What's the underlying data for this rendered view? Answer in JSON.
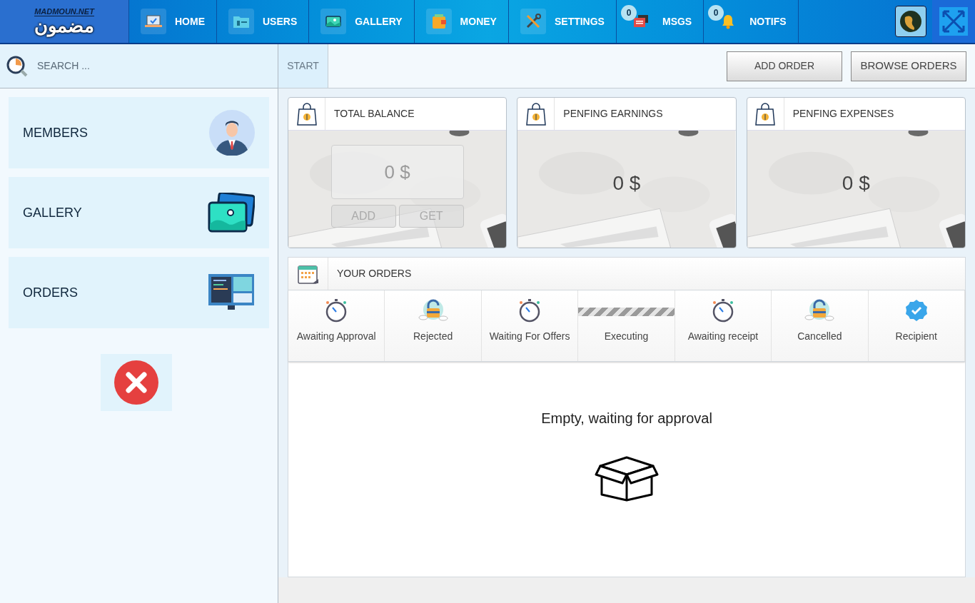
{
  "logo": {
    "latin": "MADMOUN.NET",
    "arabic": "مضمون"
  },
  "nav": [
    {
      "label": "HOME",
      "kind": "home"
    },
    {
      "label": "USERS",
      "kind": "users"
    },
    {
      "label": "GALLERY",
      "kind": "gallery"
    },
    {
      "label": "MONEY",
      "kind": "money"
    },
    {
      "label": "SETTINGS",
      "kind": "settings"
    },
    {
      "label": "MSGS",
      "kind": "msgs",
      "badge": "0"
    },
    {
      "label": "NOTIFS",
      "kind": "notifs",
      "badge": "0"
    }
  ],
  "search": {
    "placeholder": "SEARCH ..."
  },
  "sidebar": {
    "items": [
      {
        "label": "MEMBERS",
        "kind": "members"
      },
      {
        "label": "GALLERY",
        "kind": "gallery"
      },
      {
        "label": "ORDERS",
        "kind": "orders"
      }
    ]
  },
  "toolbar": {
    "tabs": [
      {
        "label": "START"
      }
    ],
    "buttons": [
      "ADD ORDER",
      "BROWSE ORDERS"
    ]
  },
  "balances": [
    {
      "title": "TOTAL BALANCE",
      "amount": "0 $",
      "kind": "editable",
      "actions": [
        "ADD",
        "GET"
      ]
    },
    {
      "title": "PENFING EARNINGS",
      "amount": "0 $",
      "kind": "plain"
    },
    {
      "title": "PENFING EXPENSES",
      "amount": "0 $",
      "kind": "plain"
    }
  ],
  "orders": {
    "title": "YOUR ORDERS",
    "statuses": [
      {
        "label": "Awaiting Approval",
        "kind": "stopwatch"
      },
      {
        "label": "Rejected",
        "kind": "lock"
      },
      {
        "label": "Waiting For Offers",
        "kind": "stopwatch"
      },
      {
        "label": "Executing",
        "kind": "progress"
      },
      {
        "label": "Awaiting receipt",
        "kind": "stopwatch"
      },
      {
        "label": "Cancelled",
        "kind": "lock"
      },
      {
        "label": "Recipient",
        "kind": "check"
      }
    ],
    "empty_message": "Empty, waiting for approval"
  }
}
